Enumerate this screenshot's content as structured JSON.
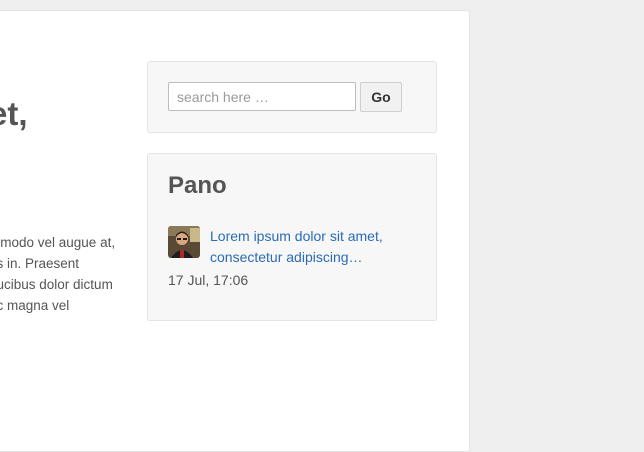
{
  "main": {
    "title_fragment": "et,",
    "excerpt_lines": [
      "mmodo vel augue at,",
      "es in. Praesent",
      "aucibus dolor dictum",
      "ac magna vel"
    ]
  },
  "search": {
    "placeholder": "search here …",
    "value": "",
    "button_label": "Go"
  },
  "recent_widget": {
    "title": "Pano",
    "posts": [
      {
        "title_lines": [
          "Lorem ipsum dolor sit amet,",
          "consectetur adipiscing…"
        ],
        "date": "17 Jul, 17:06",
        "thumbnail_icon": "user-photo-thumbnail"
      }
    ]
  },
  "colors": {
    "page_background": "#efefef",
    "card_background": "#ffffff",
    "widget_background": "#f7f7f7",
    "link": "#2a6bb8",
    "text": "#555555"
  }
}
